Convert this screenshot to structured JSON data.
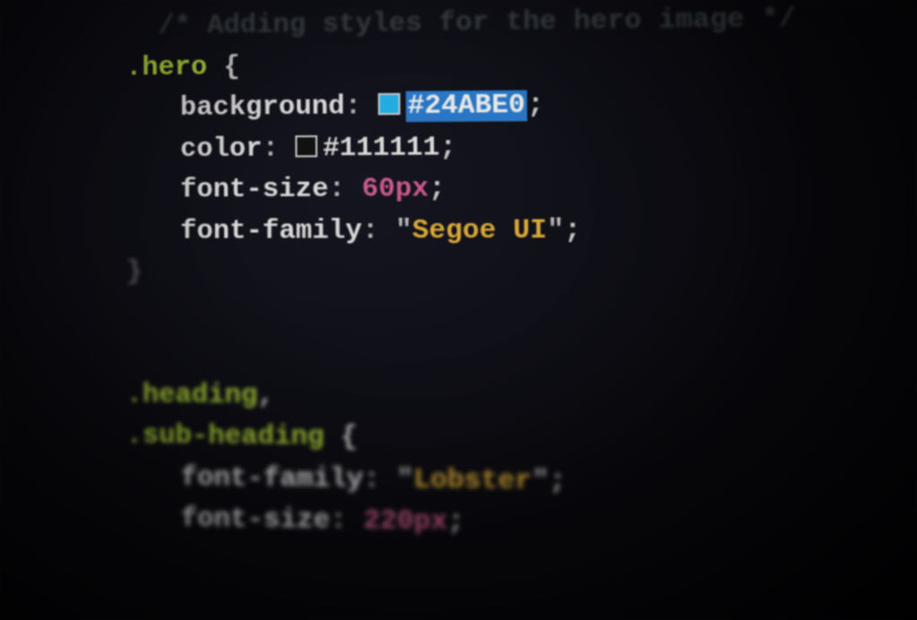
{
  "code": {
    "comment": "/* Adding styles for the hero image */",
    "rule1": {
      "selector_dot": ".",
      "selector": "hero",
      "brace_open": "{",
      "decl1": {
        "property": "background",
        "value_hex": "#24ABE0",
        "swatch_color": "#24ABE0"
      },
      "decl2": {
        "property": "color",
        "value_hex": "#111111",
        "swatch_color": "#111111"
      },
      "decl3": {
        "property": "font-size",
        "value_num": "60",
        "value_unit": "px"
      },
      "decl4": {
        "property": "font-family",
        "value_string": "Segoe UI"
      },
      "brace_close": "}"
    },
    "rule2": {
      "selector1_dot": ".",
      "selector1": "heading",
      "comma": ",",
      "selector2_dot": ".",
      "selector2": "sub-heading",
      "brace_open": "{",
      "decl1": {
        "property": "font-family",
        "value_string": "Lobster"
      },
      "decl2": {
        "property": "font-size",
        "value_num": "220",
        "value_unit": "px"
      }
    },
    "punct": {
      "colon": ":",
      "semicolon": ";",
      "quote": "\""
    }
  }
}
